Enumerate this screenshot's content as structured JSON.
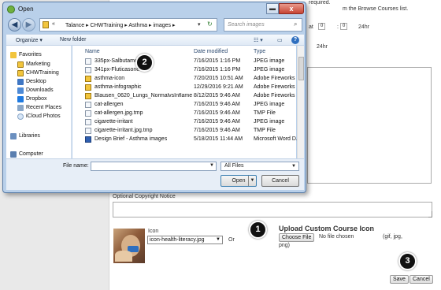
{
  "background": {
    "top_text_1": "required.",
    "top_text_2": "m the Browse Courses list.",
    "time_row_1": {
      "at": "at",
      "hour": "0",
      "minute": "0",
      "suffix": "24hr"
    },
    "time_row_2": {
      "suffix": "24hr"
    },
    "copyright_label": "Optional Copyright Notice",
    "icon_label": "Icon",
    "icon_select": "icon-health-literacy.jpg",
    "or_text": "Or",
    "upload_title": "Upload Custom Course Icon",
    "choose_file": "Choose File",
    "no_file": "No file chosen",
    "formats": "(gif, jpg,",
    "formats_2": "png)",
    "save": "Save",
    "cancel": "Cancel"
  },
  "callouts": [
    "1",
    "2",
    "3"
  ],
  "dialog": {
    "title": "Open",
    "close": "x",
    "breadcrumb": [
      "Talance",
      "CHWTraining",
      "Asthma",
      "images"
    ],
    "search_placeholder": "Search images",
    "organize": "Organize",
    "new_folder": "New folder",
    "nav_items": [
      {
        "label": "Favorites",
        "icon": "star-icon"
      },
      {
        "label": "Marketing",
        "icon": "folder-icon"
      },
      {
        "label": "CHWTraining",
        "icon": "folder-icon"
      },
      {
        "label": "Desktop",
        "icon": "desktop-icon"
      },
      {
        "label": "Downloads",
        "icon": "downloads-icon"
      },
      {
        "label": "Dropbox",
        "icon": "dropbox-icon"
      },
      {
        "label": "Recent Places",
        "icon": "recent-places-icon"
      },
      {
        "label": "iCloud Photos",
        "icon": "icloud-icon"
      },
      {
        "label": "Libraries",
        "icon": "libraries-icon"
      },
      {
        "label": "Computer",
        "icon": "computer-icon"
      }
    ],
    "columns": [
      "Name",
      "Date modified",
      "Type"
    ],
    "files": [
      {
        "name": "335px-Salbutamol2",
        "date": "7/16/2015 1:16 PM",
        "type": "JPEG image",
        "icon": "image"
      },
      {
        "name": "341px-Fluticasone",
        "date": "7/16/2015 1:16 PM",
        "type": "JPEG image",
        "icon": "image"
      },
      {
        "name": "asthma-icon",
        "date": "7/20/2015 10:51 AM",
        "type": "Adobe Fireworks ...",
        "icon": "fireworks"
      },
      {
        "name": "asthma-infographic",
        "date": "12/29/2016 9:21 AM",
        "type": "Adobe Fireworks ...",
        "icon": "fireworks"
      },
      {
        "name": "Blausen_0620_Lungs_NormalvsInflamed...",
        "date": "8/12/2015 9:46 AM",
        "type": "Adobe Fireworks ...",
        "icon": "fireworks"
      },
      {
        "name": "cat-allergen",
        "date": "7/16/2015 9:46 AM",
        "type": "JPEG image",
        "icon": "image"
      },
      {
        "name": "cat-allergen.jpg.tmp",
        "date": "7/16/2015 9:46 AM",
        "type": "TMP File",
        "icon": "file"
      },
      {
        "name": "cigarette-irritant",
        "date": "7/16/2015 9:46 AM",
        "type": "JPEG image",
        "icon": "image"
      },
      {
        "name": "cigarette-irritant.jpg.tmp",
        "date": "7/16/2015 9:46 AM",
        "type": "TMP File",
        "icon": "file"
      },
      {
        "name": "Design Brief - Asthma images",
        "date": "5/18/2015 11:44 AM",
        "type": "Microsoft Word D...",
        "icon": "word"
      }
    ],
    "file_name_label": "File name:",
    "file_name_value": "",
    "filter": "All Files",
    "open": "Open",
    "cancel": "Cancel"
  }
}
